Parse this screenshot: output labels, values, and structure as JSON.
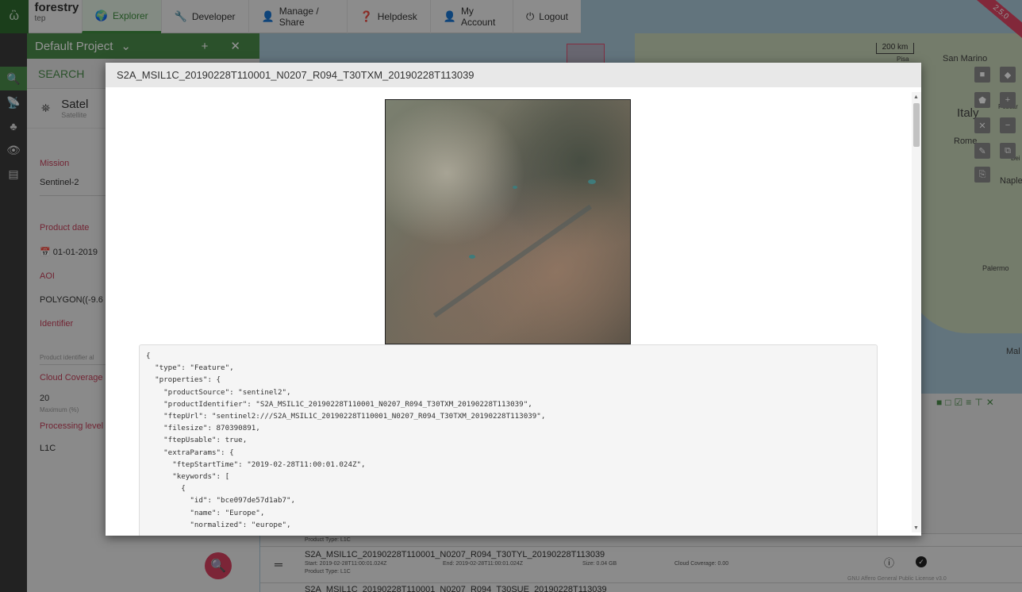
{
  "nav": {
    "brand": "forestry",
    "brand_sub": "tep",
    "items": [
      {
        "label": "Explorer",
        "icon": "globe-icon"
      },
      {
        "label": "Developer",
        "icon": "wrench-icon"
      },
      {
        "label": "Manage / Share",
        "icon": "person-icon"
      },
      {
        "label": "Helpdesk",
        "icon": "help-icon"
      },
      {
        "label": "My Account",
        "icon": "account-icon"
      },
      {
        "label": "Logout",
        "icon": "power-icon"
      }
    ],
    "version_ribbon": "2.5.0"
  },
  "panel": {
    "project": "Default Project",
    "search_header": "SEARCH",
    "sat_title": "Satel",
    "sat_subtitle": "Satellite",
    "mission_label": "Mission",
    "mission_value": "Sentinel-2",
    "product_date_label": "Product date",
    "product_date_value": "01-01-2019",
    "aoi_label": "AOI",
    "aoi_value": "POLYGON((-9.6",
    "identifier_label": "Identifier",
    "identifier_placeholder": "Product identifier al",
    "cloud_label": "Cloud Coverage",
    "cloud_value": "20",
    "cloud_sub": "Maximum (%)",
    "proc_label": "Processing level (",
    "proc_value": "L1C"
  },
  "map": {
    "scale": "200 km",
    "labels": [
      "San Marino",
      "Pisa",
      "Italy",
      "Rome",
      "Naple",
      "Palermo",
      "Mal",
      "Pescar",
      "Bei"
    ]
  },
  "results": {
    "rows": [
      {
        "title": "",
        "sub": "Product Type: L1C"
      },
      {
        "title": "S2A_MSIL1C_20190228T110001_N0207_R094_T30TYL_20190228T113039",
        "start": "Start: 2019-02-28T11:00:01.024Z",
        "end": "End: 2019-02-28T11:00:01.024Z",
        "size": "Size: 0.04 GB",
        "cloud": "Cloud Coverage: 0.00",
        "type": "Product Type: L1C"
      },
      {
        "title": "S2A_MSIL1C_20190228T110001_N0207_R094_T30SUE_20190228T113039"
      }
    ],
    "license": "GNU Affero General Public License v3.0"
  },
  "modal": {
    "title": "S2A_MSIL1C_20190228T110001_N0207_R094_T30TXM_20190228T113039",
    "json_lines": [
      "{",
      "  \"type\": \"Feature\",",
      "  \"properties\": {",
      "    \"productSource\": \"sentinel2\",",
      "    \"productIdentifier\": \"S2A_MSIL1C_20190228T110001_N0207_R094_T30TXM_20190228T113039\",",
      "    \"ftepUrl\": \"sentinel2:///S2A_MSIL1C_20190228T110001_N0207_R094_T30TXM_20190228T113039\",",
      "    \"filesize\": 870390891,",
      "    \"ftepUsable\": true,",
      "    \"extraParams\": {",
      "      \"ftepStartTime\": \"2019-02-28T11:00:01.024Z\",",
      "      \"keywords\": [",
      "        {",
      "          \"id\": \"bce097de57d1ab7\",",
      "          \"name\": \"Europe\",",
      "          \"normalized\": \"europe\","
    ]
  }
}
